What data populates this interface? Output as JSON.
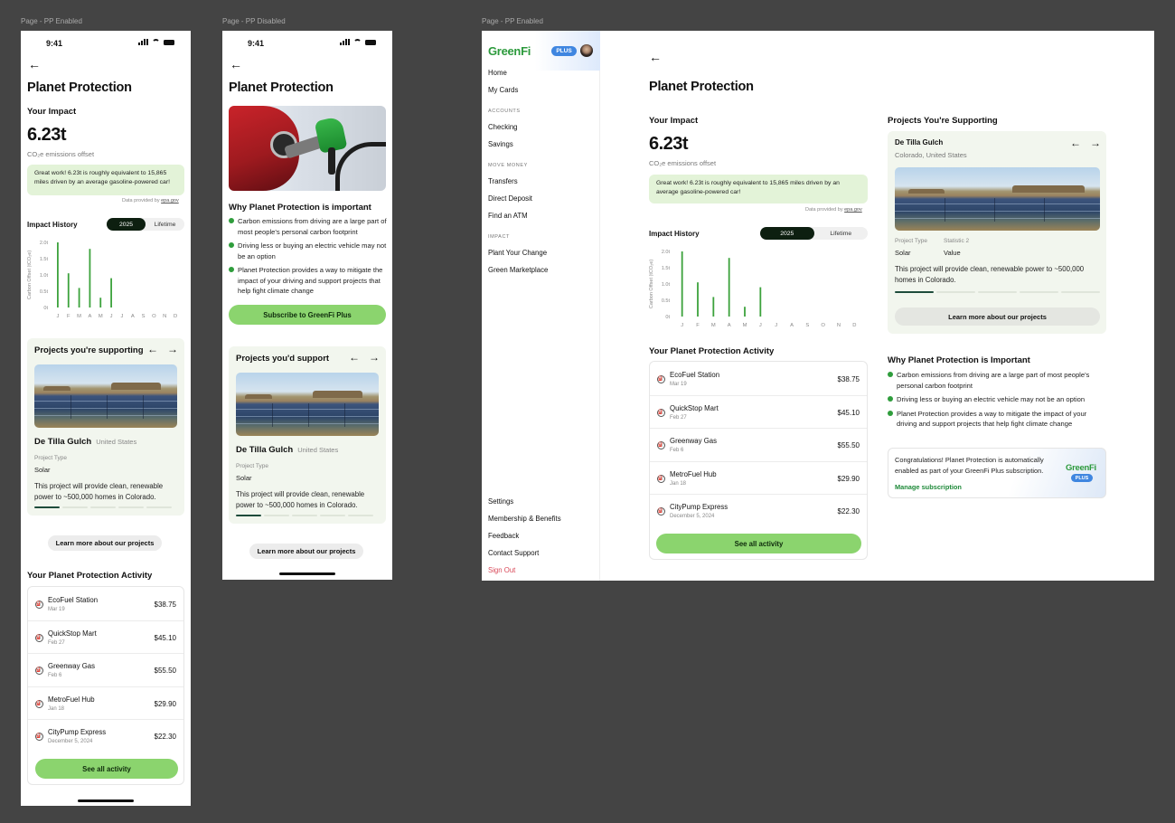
{
  "frames": {
    "enabled_mobile": "Page - PP Enabled",
    "disabled_mobile": "Page - PP Disabled",
    "enabled_desktop": "Page - PP Enabled"
  },
  "status": {
    "time": "9:41"
  },
  "page_title": "Planet Protection",
  "impact": {
    "heading": "Your Impact",
    "value": "6.23t",
    "unit": "CO₂e emissions offset",
    "message": "Great work! 6.23t is roughly equivalent to 15,865 miles driven by an average gasoline-powered car!",
    "source_prefix": "Data provided by",
    "source_link": "epa.gov"
  },
  "history": {
    "heading": "Impact History",
    "toggle": [
      "2025",
      "Lifetime"
    ],
    "selected": "2025"
  },
  "chart_data": {
    "type": "bar",
    "categories": [
      "J",
      "F",
      "M",
      "A",
      "M",
      "J",
      "J",
      "A",
      "S",
      "O",
      "N",
      "D"
    ],
    "values": [
      2.0,
      1.05,
      0.6,
      1.8,
      0.3,
      0.9,
      0,
      0,
      0,
      0,
      0,
      0
    ],
    "ylabel": "Carbon Offset (tCO₂e)",
    "yticks": [
      "2.0t",
      "1.5t",
      "1.0t",
      "0.5t",
      "0t"
    ],
    "ylim": [
      0,
      2.0
    ],
    "color": "#3ca23c"
  },
  "projects": {
    "heading_mobile_enabled": "Projects you're supporting",
    "heading_mobile_disabled": "Projects you'd support",
    "heading_desktop": "Projects You're Supporting",
    "name": "De Tilla Gulch",
    "country": "United States",
    "location_full": "Colorado, United States",
    "type_label": "Project Type",
    "type_value": "Solar",
    "stat_label": "Statistic 2",
    "stat_value": "Value",
    "description": "This project will provide clean, renewable power to ~500,000 homes in Colorado.",
    "learn_more": "Learn more about our projects",
    "prev_icon": "←",
    "next_icon": "→"
  },
  "activity": {
    "heading": "Your Planet Protection Activity",
    "items": [
      {
        "merchant": "EcoFuel Station",
        "date": "Mar 19",
        "amount": "$38.75"
      },
      {
        "merchant": "QuickStop Mart",
        "date": "Feb 27",
        "amount": "$45.10"
      },
      {
        "merchant": "Greenway Gas",
        "date": "Feb 6",
        "amount": "$55.50"
      },
      {
        "merchant": "MetroFuel Hub",
        "date": "Jan 18",
        "amount": "$29.90"
      },
      {
        "merchant": "CityPump Express",
        "date": "December 5, 2024",
        "amount": "$22.30"
      }
    ],
    "see_all": "See all activity"
  },
  "why": {
    "heading_mobile": "Why Planet Protection is important",
    "heading_desktop": "Why Planet Protection is Important",
    "points": [
      "Carbon emissions from driving are a large part of most people's personal carbon footprint",
      "Driving less or buying an electric vehicle may not be an option",
      "Planet Protection provides a way to mitigate the impact of your driving and support projects that help fight climate change"
    ]
  },
  "subscribe": "Subscribe to GreenFi Plus",
  "sidebar": {
    "logo": "GreenFi",
    "plus": "PLUS",
    "top": [
      "Home",
      "My Cards"
    ],
    "sections": [
      {
        "title": "ACCOUNTS",
        "items": [
          "Checking",
          "Savings"
        ]
      },
      {
        "title": "MOVE MONEY",
        "items": [
          "Transfers",
          "Direct Deposit",
          "Find an ATM"
        ]
      },
      {
        "title": "IMPACT",
        "items": [
          "Plant Your Change",
          "Green Marketplace"
        ]
      }
    ],
    "bottom": [
      "Settings",
      "Membership & Benefits",
      "Feedback",
      "Contact Support"
    ],
    "signout": "Sign Out"
  },
  "congrats": {
    "text": "Congratulations! Planet Protection is automatically enabled as part of your GreenFi Plus subscription.",
    "link": "Manage subscription",
    "logo": "GreenFi",
    "badge": "PLUS"
  }
}
